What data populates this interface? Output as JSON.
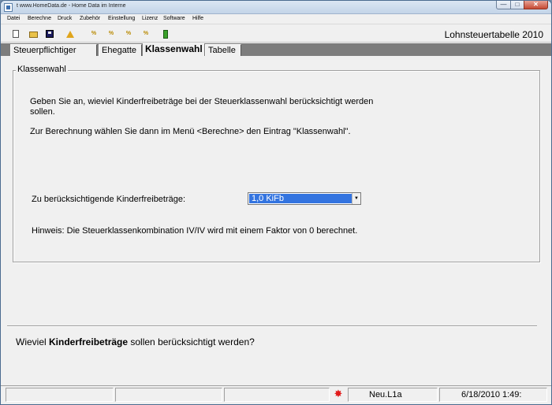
{
  "window": {
    "title": "t  www.HomeData.de  -  Home Data im Interne",
    "minimize_glyph": "—",
    "maximize_glyph": "□",
    "close_glyph": "✕"
  },
  "menu": [
    "Datei",
    "Berechne",
    "Druck",
    "Zubehör",
    "Einstellung",
    "Lizenz",
    "Software",
    "Hilfe"
  ],
  "toolbar": {
    "icons": [
      "new-document-icon",
      "open-folder-icon",
      "save-icon",
      "warning-icon",
      "calc-icon",
      "calc-icon",
      "calc-icon",
      "calc-icon",
      "battery-icon"
    ],
    "calc_glyph": "%"
  },
  "app_title": "Lohnsteuertabelle 2010",
  "tabs": [
    "Steuerpflichtiger",
    "Ehegatte",
    "Klassenwahl",
    "Tabelle"
  ],
  "active_tab": "Klassenwahl",
  "group": {
    "legend": "Klassenwahl",
    "text1": "Geben Sie an, wieviel Kinderfreibeträge bei der Steuerklassenwahl berücksichtigt werden sollen.",
    "text2": "Zur Berechnung wählen Sie dann im Menü <Berechne> den Eintrag \"Klassenwahl\".",
    "combo_label": "Zu berücksichtigende Kinderfreibeträge:",
    "combo_value": "1,0 KiFb",
    "combo_arrow": "▼",
    "hint": "Hinweis: Die Steuerklassenkombination IV/IV wird mit einem Faktor von 0 berechnet."
  },
  "bottom_question": {
    "prefix": "Wieviel ",
    "bold": "Kinderfreibeträge",
    "suffix": " sollen berücksichtigt werden?"
  },
  "status": {
    "icon_glyph": "✸",
    "file": "Neu.L1a",
    "datetime": "6/18/2010  1:49:"
  },
  "colors": {
    "selection": "#3374e0",
    "status_icon": "#e11a1a",
    "tabstrip": "#7d7d7d"
  }
}
